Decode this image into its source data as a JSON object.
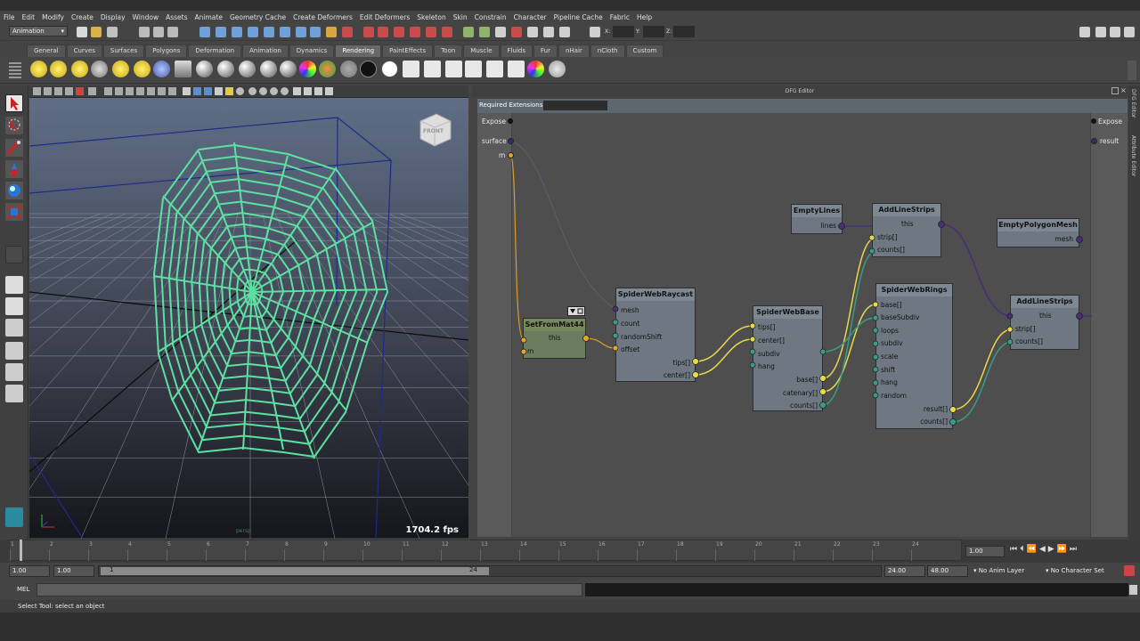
{
  "menu": [
    "File",
    "Edit",
    "Modify",
    "Create",
    "Display",
    "Window",
    "Assets",
    "Animate",
    "Geometry Cache",
    "Create Deformers",
    "Edit Deformers",
    "Skeleton",
    "Skin",
    "Constrain",
    "Character",
    "Pipeline Cache",
    "Fabric",
    "Help"
  ],
  "status_line": {
    "mode": "Animation",
    "x_label": "X:",
    "y_label": "Y:",
    "z_label": "Z:"
  },
  "shelf_tabs": [
    "General",
    "Curves",
    "Surfaces",
    "Polygons",
    "Deformation",
    "Animation",
    "Dynamics",
    "Rendering",
    "PaintEffects",
    "Toon",
    "Muscle",
    "Fluids",
    "Fur",
    "nHair",
    "nCloth",
    "Custom"
  ],
  "active_shelf_tab": "Rendering",
  "viewport": {
    "fps": "1704.2 fps",
    "view_cube": "FRONT",
    "camera": "persp"
  },
  "dfg": {
    "title": "DFG Editor",
    "required_extensions_label": "Required Extensions:",
    "expose_left": "Expose",
    "expose_right": "Expose",
    "left_ports": [
      "surface",
      "m"
    ],
    "right_ports": [
      "result"
    ],
    "nodes": {
      "set_from_mat44": {
        "title": "SetFromMat44",
        "ports": [
          "this",
          "m"
        ]
      },
      "raycast": {
        "title": "SpiderWebRaycast",
        "inputs": [
          "mesh",
          "count",
          "randomShift",
          "offset"
        ],
        "outputs": [
          "tips[]",
          "center[]"
        ]
      },
      "web_base": {
        "title": "SpiderWebBase",
        "inputs": [
          "tips[]",
          "center[]",
          "subdiv",
          "hang"
        ],
        "outputs": [
          "base[]",
          "catenary[]",
          "counts[]"
        ]
      },
      "empty_lines": {
        "title": "EmptyLines",
        "outputs": [
          "lines"
        ]
      },
      "add_line_strips_1": {
        "title": "AddLineStrips",
        "ports": [
          "this",
          "strip[]",
          "counts[]"
        ]
      },
      "web_rings": {
        "title": "SpiderWebRings",
        "inputs": [
          "base[]",
          "baseSubdiv",
          "loops",
          "subdiv",
          "scale",
          "shift",
          "hang",
          "random"
        ],
        "outputs": [
          "result[]",
          "counts[]"
        ]
      },
      "empty_polygon_mesh": {
        "title": "EmptyPolygonMesh",
        "outputs": [
          "mesh"
        ]
      },
      "add_line_strips_2": {
        "title": "AddLineStrips",
        "ports": [
          "this",
          "strip[]",
          "counts[]"
        ]
      }
    }
  },
  "side_tabs": [
    "DFG Editor",
    "Attribute Editor"
  ],
  "timeline": {
    "ticks": [
      "1",
      "2",
      "3",
      "4",
      "5",
      "6",
      "7",
      "8",
      "9",
      "10",
      "11",
      "12",
      "13",
      "14",
      "15",
      "16",
      "17",
      "18",
      "19",
      "20",
      "21",
      "22",
      "23",
      "24"
    ],
    "current_frame": "1.00"
  },
  "range": {
    "start": "1.00",
    "playback_start": "1.00",
    "slider_start": "1",
    "slider_end": "24",
    "playback_end": "24.00",
    "end": "48.00",
    "anim_layer": "No Anim Layer",
    "character_set": "No Character Set"
  },
  "command_line": {
    "label": "MEL"
  },
  "help_line": "Select Tool: select an object",
  "colors": {
    "web": "#5de0a2",
    "wire_yellow": "#e8d84a",
    "wire_purple": "#4a2e7a",
    "wire_teal": "#3a9b85"
  }
}
